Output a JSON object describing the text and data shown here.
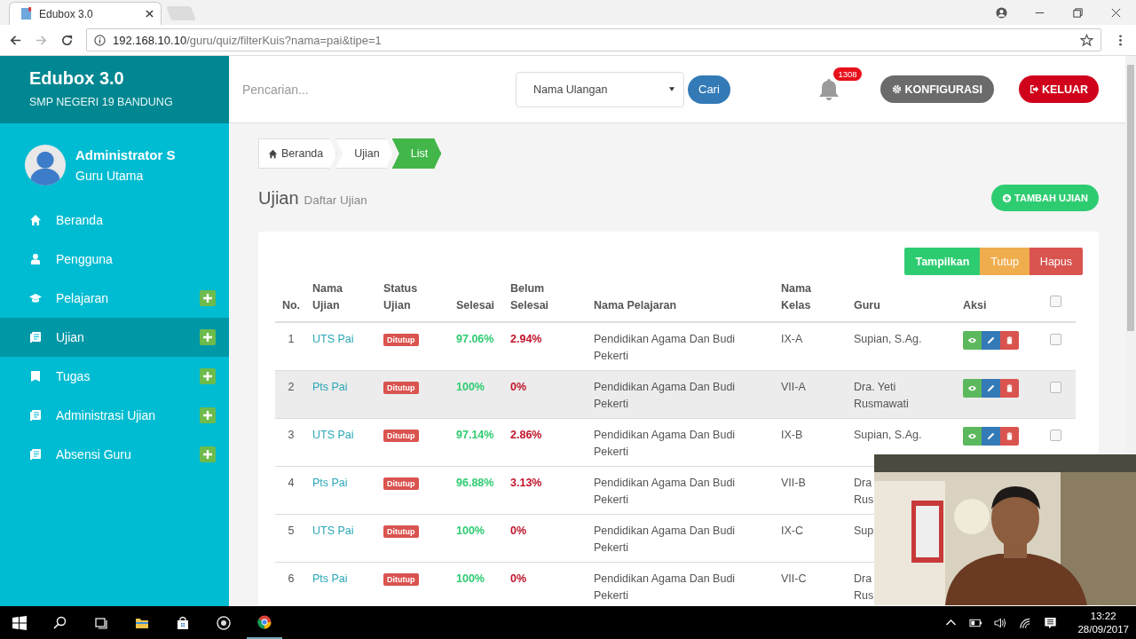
{
  "browser": {
    "tab_title": "Edubox 3.0",
    "url_host": "192.168.10.10",
    "url_path": "/guru/quiz/filterKuis?nama=pai&tipe=1"
  },
  "sidebar": {
    "brand": "Edubox 3.0",
    "school": "SMP NEGERI 19 BANDUNG",
    "user": {
      "name": "Administrator S",
      "role": "Guru Utama"
    },
    "items": [
      {
        "label": "Beranda",
        "kind": "home",
        "expandable": false,
        "selected": false
      },
      {
        "label": "Pengguna",
        "kind": "user",
        "expandable": false,
        "selected": false
      },
      {
        "label": "Pelajaran",
        "kind": "cap",
        "expandable": true,
        "selected": false
      },
      {
        "label": "Ujian",
        "kind": "list",
        "expandable": true,
        "selected": true
      },
      {
        "label": "Tugas",
        "kind": "book",
        "expandable": true,
        "selected": false
      },
      {
        "label": "Administrasi Ujian",
        "kind": "list",
        "expandable": true,
        "selected": false
      },
      {
        "label": "Absensi Guru",
        "kind": "list",
        "expandable": true,
        "selected": false
      }
    ]
  },
  "topbar": {
    "search_placeholder": "Pencarian...",
    "select_value": "Nama Ulangan",
    "search_button": "Cari",
    "notification_count": "1308",
    "config_button": "KONFIGURASI",
    "logout_button": "KELUAR"
  },
  "breadcrumb": [
    {
      "label": "Beranda",
      "home": true,
      "selected": false
    },
    {
      "label": "Ujian",
      "home": false,
      "selected": false
    },
    {
      "label": "List",
      "home": false,
      "selected": true
    }
  ],
  "page": {
    "title": "Ujian",
    "subtitle": "Daftar Ujian",
    "add_button": "TAMBAH UJIAN"
  },
  "bulk_actions": [
    {
      "label": "Tampilkan",
      "kind": "show"
    },
    {
      "label": "Tutup",
      "kind": "close"
    },
    {
      "label": "Hapus",
      "kind": "delete"
    }
  ],
  "table": {
    "columns": [
      [
        "No."
      ],
      [
        "Nama",
        "Ujian"
      ],
      [
        "Status",
        "Ujian"
      ],
      [
        "Selesai"
      ],
      [
        "Belum",
        "Selesai"
      ],
      [
        "Nama Pelajaran"
      ],
      [
        "Nama",
        "Kelas"
      ],
      [
        "Guru"
      ],
      [
        "Aksi"
      ]
    ],
    "select_all_checked": false,
    "rows": [
      {
        "no": "1",
        "name": "UTS Pai",
        "status": "Ditutup",
        "done": "97.06%",
        "not_done": "2.94%",
        "subject": "Pendidikan Agama Dan Budi Pekerti",
        "class": "IX-A",
        "teacher": [
          "Supian, S.Ag."
        ],
        "show_actions": true,
        "checked": false,
        "hovered": false
      },
      {
        "no": "2",
        "name": "Pts Pai",
        "status": "Ditutup",
        "done": "100%",
        "not_done": "0%",
        "subject": "Pendidikan Agama Dan Budi Pekerti",
        "class": "VII-A",
        "teacher": [
          "Dra. Yeti",
          "Rusmawati"
        ],
        "show_actions": true,
        "checked": false,
        "hovered": true
      },
      {
        "no": "3",
        "name": "UTS Pai",
        "status": "Ditutup",
        "done": "97.14%",
        "not_done": "2.86%",
        "subject": "Pendidikan Agama Dan Budi Pekerti",
        "class": "IX-B",
        "teacher": [
          "Supian, S.Ag."
        ],
        "show_actions": true,
        "checked": false,
        "hovered": false
      },
      {
        "no": "4",
        "name": "Pts Pai",
        "status": "Ditutup",
        "done": "96.88%",
        "not_done": "3.13%",
        "subject": "Pendidikan Agama Dan Budi Pekerti",
        "class": "VII-B",
        "teacher": [
          "Dra",
          "Rus"
        ],
        "show_actions": false,
        "hovered": false
      },
      {
        "no": "5",
        "name": "UTS Pai",
        "status": "Ditutup",
        "done": "100%",
        "not_done": "0%",
        "subject": "Pendidikan Agama Dan Budi Pekerti",
        "class": "IX-C",
        "teacher": [
          "Sup"
        ],
        "show_actions": false,
        "hovered": false
      },
      {
        "no": "6",
        "name": "Pts Pai",
        "status": "Ditutup",
        "done": "100%",
        "not_done": "0%",
        "subject": "Pendidikan Agama Dan Budi Pekerti",
        "class": "VII-C",
        "teacher": [
          "Dra",
          "Rus"
        ],
        "show_actions": false,
        "hovered": false
      }
    ]
  },
  "taskbar": {
    "time": "13:22",
    "date": "28/09/2017"
  }
}
